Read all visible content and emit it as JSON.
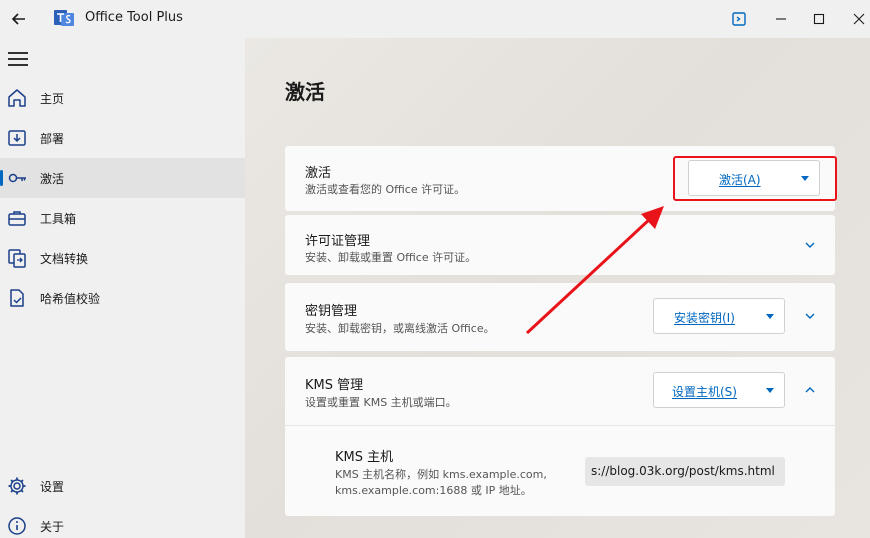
{
  "app": {
    "title": "Office Tool Plus"
  },
  "sidebar": {
    "items": [
      {
        "label": "主页",
        "icon": "home-icon"
      },
      {
        "label": "部署",
        "icon": "deploy-icon"
      },
      {
        "label": "激活",
        "icon": "key-icon",
        "active": true
      },
      {
        "label": "工具箱",
        "icon": "toolbox-icon"
      },
      {
        "label": "文档转换",
        "icon": "document-convert-icon"
      },
      {
        "label": "哈希值校验",
        "icon": "hash-check-icon"
      }
    ],
    "bottom_items": [
      {
        "label": "设置",
        "icon": "gear-icon"
      },
      {
        "label": "关于",
        "icon": "info-icon"
      }
    ]
  },
  "main": {
    "title": "激活",
    "cards": {
      "activation": {
        "title": "激活",
        "desc": "激活或查看您的 Office 许可证。",
        "button": "激活(A)"
      },
      "license": {
        "title": "许可证管理",
        "desc": "安装、卸载或重置 Office 许可证。"
      },
      "key": {
        "title": "密钥管理",
        "desc": "安装、卸载密钥，或离线激活 Office。",
        "button": "安装密钥(I)"
      },
      "kms": {
        "title": "KMS 管理",
        "desc": "设置或重置 KMS 主机或端口。",
        "button": "设置主机(S)"
      }
    },
    "kms_host": {
      "title": "KMS 主机",
      "desc_line1": "KMS 主机名称，例如 kms.example.com,",
      "desc_line2": "kms.example.com:1688 或 IP 地址。",
      "value": "s://blog.03k.org/post/kms.html"
    }
  },
  "colors": {
    "accent": "#0067c0",
    "annotation": "#e8141a"
  }
}
